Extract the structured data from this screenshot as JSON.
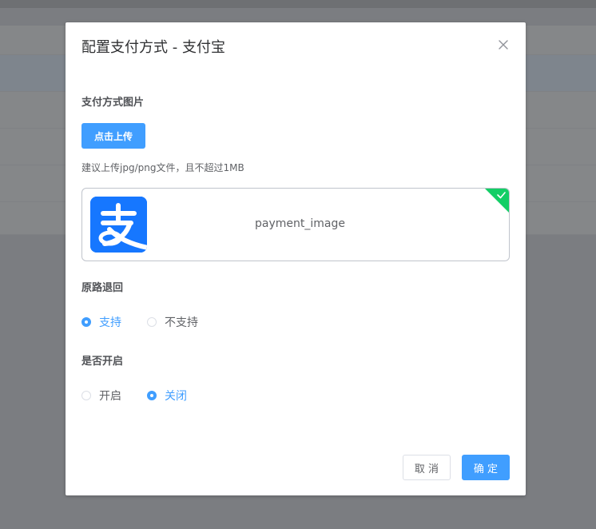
{
  "dialog": {
    "title": "配置支付方式 - 支付宝",
    "close_icon": "close-icon"
  },
  "image_section": {
    "label": "支付方式图片",
    "upload_button": "点击上传",
    "tip": "建议上传jpg/png文件，且不超过1MB",
    "file_name": "payment_image",
    "thumbnail_icon": "alipay-logo",
    "status_icon": "check-icon",
    "status_color": "#13ce66"
  },
  "refund_section": {
    "label": "原路退回",
    "options": [
      {
        "label": "支持",
        "checked": true
      },
      {
        "label": "不支持",
        "checked": false
      }
    ]
  },
  "enable_section": {
    "label": "是否开启",
    "options": [
      {
        "label": "开启",
        "checked": false
      },
      {
        "label": "关闭",
        "checked": true
      }
    ]
  },
  "footer": {
    "cancel": "取 消",
    "confirm": "确 定"
  },
  "colors": {
    "primary": "#409eff",
    "alipay_blue": "#1677ff",
    "overlay": "#7b7d81"
  }
}
